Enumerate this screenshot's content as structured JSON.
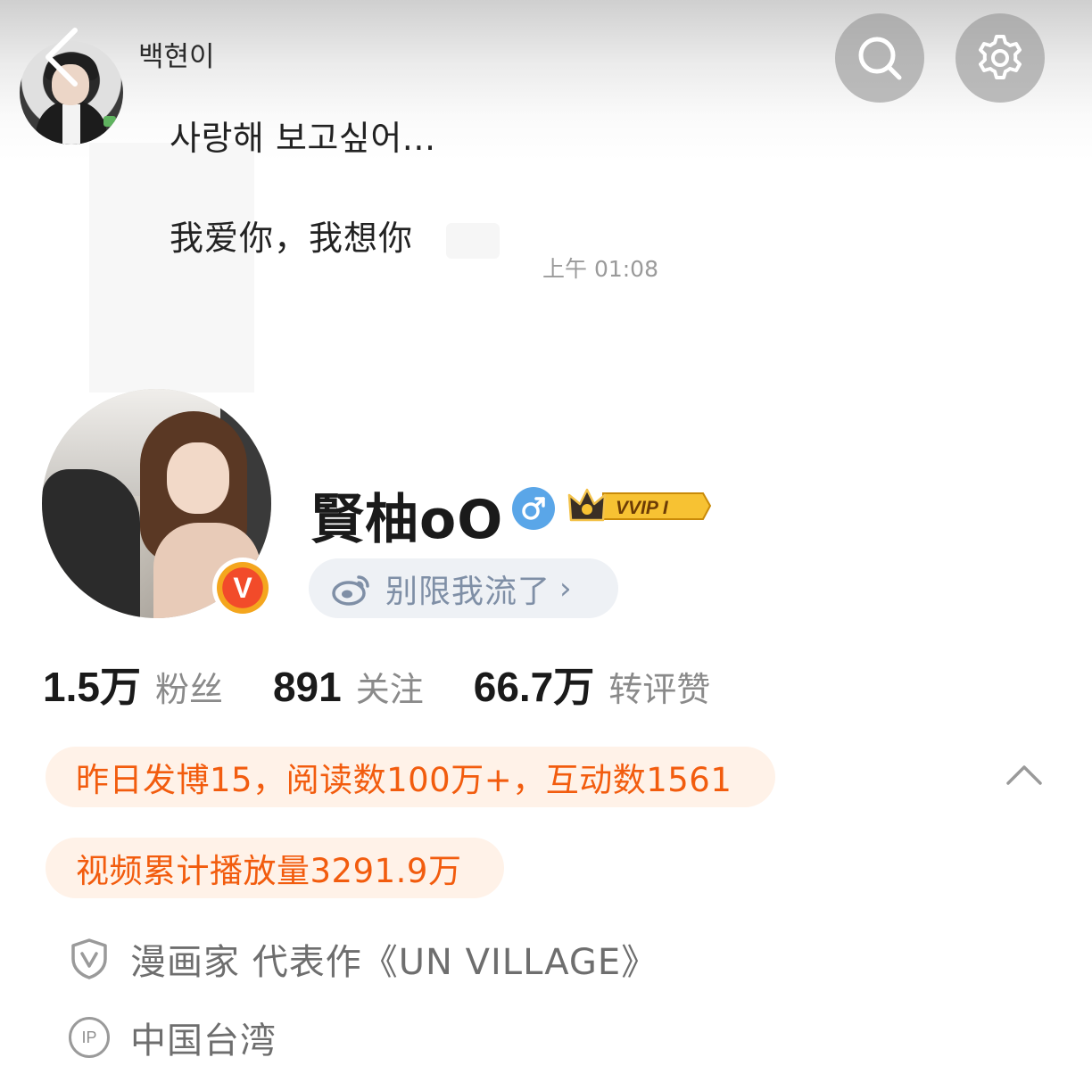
{
  "chat": {
    "sender": "백현이",
    "line1": "사랑해 보고싶어...",
    "line2": "我爱你，我想你",
    "time": "上午 01:08"
  },
  "header": {
    "back_icon": "back-arrow-icon",
    "search_icon": "search-icon",
    "settings_icon": "gear-icon"
  },
  "profile": {
    "username": "賢柚oO",
    "gender_icon": "male-icon",
    "member_badge": "VVIP I",
    "verified_badge": "V",
    "weibo_tag": "别限我流了",
    "weibo_tag_chevron": "›"
  },
  "stats": [
    {
      "value": "1.5万",
      "label": "粉丝"
    },
    {
      "value": "891",
      "label": "关注"
    },
    {
      "value": "66.7万",
      "label": "转评赞"
    }
  ],
  "highlights": {
    "line1": "昨日发博15，阅读数100万+，互动数1561",
    "line2": "视频累计播放量3291.9万",
    "collapse_icon": "chevron-up-icon"
  },
  "info": {
    "verification": "漫画家 代表作《UN VILLAGE》",
    "ip_icon_text": "IP",
    "ip_location": "中国台湾"
  },
  "colors": {
    "accent_orange": "#f25c0e",
    "pill_bg": "#fff2e8",
    "tag_bg": "#eef1f5",
    "gender_blue": "#5aa6e8"
  }
}
